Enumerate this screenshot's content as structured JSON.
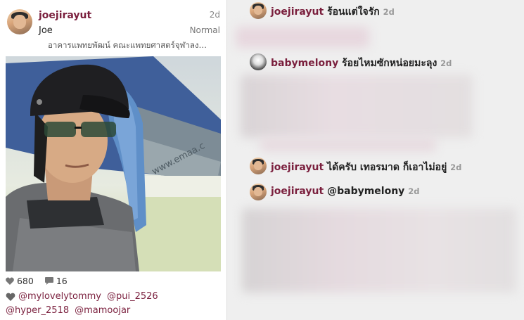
{
  "post": {
    "username": "joejirayut",
    "full_name": "Joe",
    "time": "2d",
    "filter": "Normal",
    "location": "อาคารแพทยพัฒน์ คณะแพทยศาสตร์จุฬาลง…",
    "likes": "680",
    "comments_count": "16",
    "likers": [
      "@mylovelytommy",
      "@pui_2526",
      "@hyper_2518",
      "@mamoojar"
    ],
    "photo_watermark": "www.emaa.c"
  },
  "comments": [
    {
      "username": "joejirayut",
      "text": "ร้อนแต่ใจรัก",
      "time": "2d"
    },
    {
      "username": "babymelony",
      "text": "ร้อยไหมซักหน่อยมะลุง",
      "time": "2d"
    },
    {
      "username": "joejirayut",
      "text": "ได้ครับ เทอรมาด ก็เอาไม่อยู่",
      "time": "2d"
    },
    {
      "username": "joejirayut",
      "text": "@babymelony",
      "time": "2d"
    }
  ],
  "colors": {
    "username": "#7a1f3d",
    "background": "#efefef",
    "card": "#ffffff"
  }
}
